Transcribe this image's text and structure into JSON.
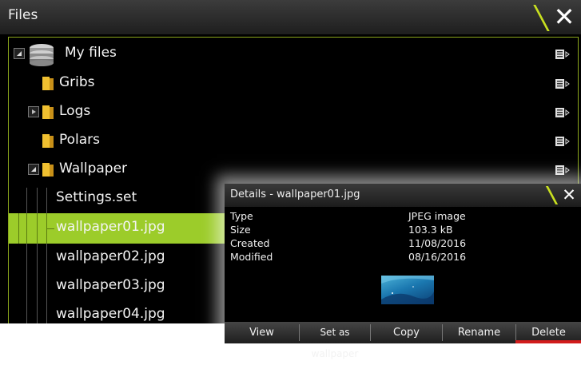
{
  "files": {
    "title": "Files",
    "close_icon": "x-icon",
    "root": {
      "label": "My files",
      "icon": "drive-stack-icon"
    },
    "items": [
      {
        "label": "Gribs",
        "type": "folder"
      },
      {
        "label": "Logs",
        "type": "folder"
      },
      {
        "label": "Polars",
        "type": "folder"
      },
      {
        "label": "Wallpaper",
        "type": "folder"
      },
      {
        "label": "Settings.set",
        "type": "file"
      },
      {
        "label": "wallpaper01.jpg",
        "type": "file",
        "selected": true
      },
      {
        "label": "wallpaper02.jpg",
        "type": "file"
      },
      {
        "label": "wallpaper03.jpg",
        "type": "file"
      },
      {
        "label": "wallpaper04.jpg",
        "type": "file"
      }
    ]
  },
  "details": {
    "title": "Details - wallpaper01.jpg",
    "props": [
      {
        "key": "Type",
        "value": "JPEG image"
      },
      {
        "key": "Size",
        "value": "103.3 kB"
      },
      {
        "key": "Created",
        "value": "11/08/2016"
      },
      {
        "key": "Modified",
        "value": "08/16/2016"
      }
    ],
    "buttons": {
      "view": "View",
      "wallpaper": "Set as wallpaper",
      "copy": "Copy",
      "rename": "Rename",
      "delete": "Delete"
    }
  },
  "colors": {
    "accent": "#9ccc2a",
    "slash": "#c8e020",
    "delete": "#d11c1c",
    "frame": "#8aa61c"
  }
}
